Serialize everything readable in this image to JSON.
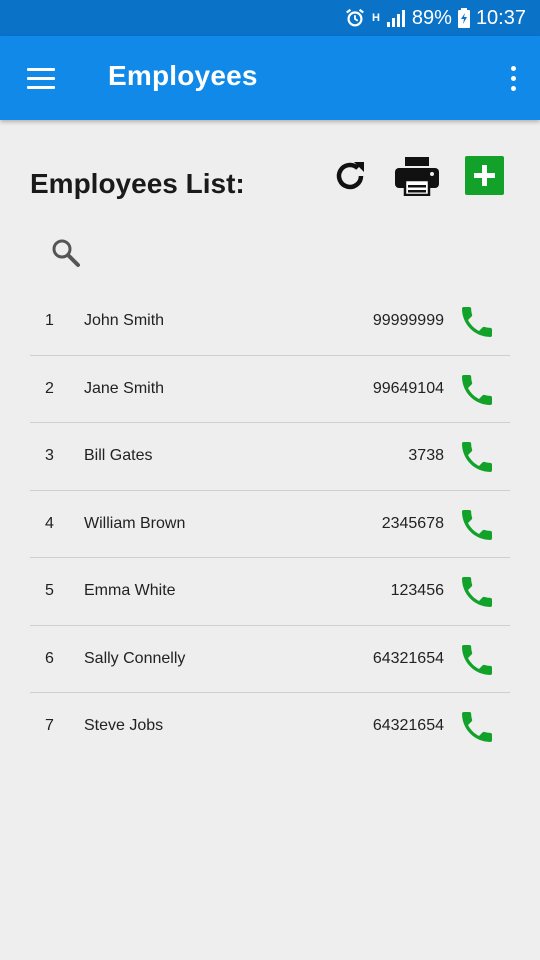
{
  "status_bar": {
    "battery": "89%",
    "time": "10:37",
    "network": "H"
  },
  "app_bar": {
    "title": "Employees",
    "menu_icon": "hamburger-menu-icon",
    "overflow_icon": "more-vert-icon"
  },
  "page": {
    "list_title": "Employees List:"
  },
  "toolbar": {
    "refresh_icon": "refresh-icon",
    "print_icon": "print-icon",
    "add_icon": "add-icon",
    "add_color": "#12a22a"
  },
  "search": {
    "icon": "search-icon"
  },
  "employees": [
    {
      "index": "1",
      "name": "John Smith",
      "phone": "99999999"
    },
    {
      "index": "2",
      "name": "Jane Smith",
      "phone": "99649104"
    },
    {
      "index": "3",
      "name": "Bill Gates",
      "phone": "3738"
    },
    {
      "index": "4",
      "name": "William Brown",
      "phone": "2345678"
    },
    {
      "index": "5",
      "name": "Emma White",
      "phone": "123456"
    },
    {
      "index": "6",
      "name": "Sally Connelly",
      "phone": "64321654"
    },
    {
      "index": "7",
      "name": "Steve Jobs",
      "phone": "64321654"
    }
  ],
  "colors": {
    "status_bar": "#0a73c8",
    "app_bar": "#1189e8",
    "call_icon": "#12a22a",
    "background": "#eeeeee"
  }
}
